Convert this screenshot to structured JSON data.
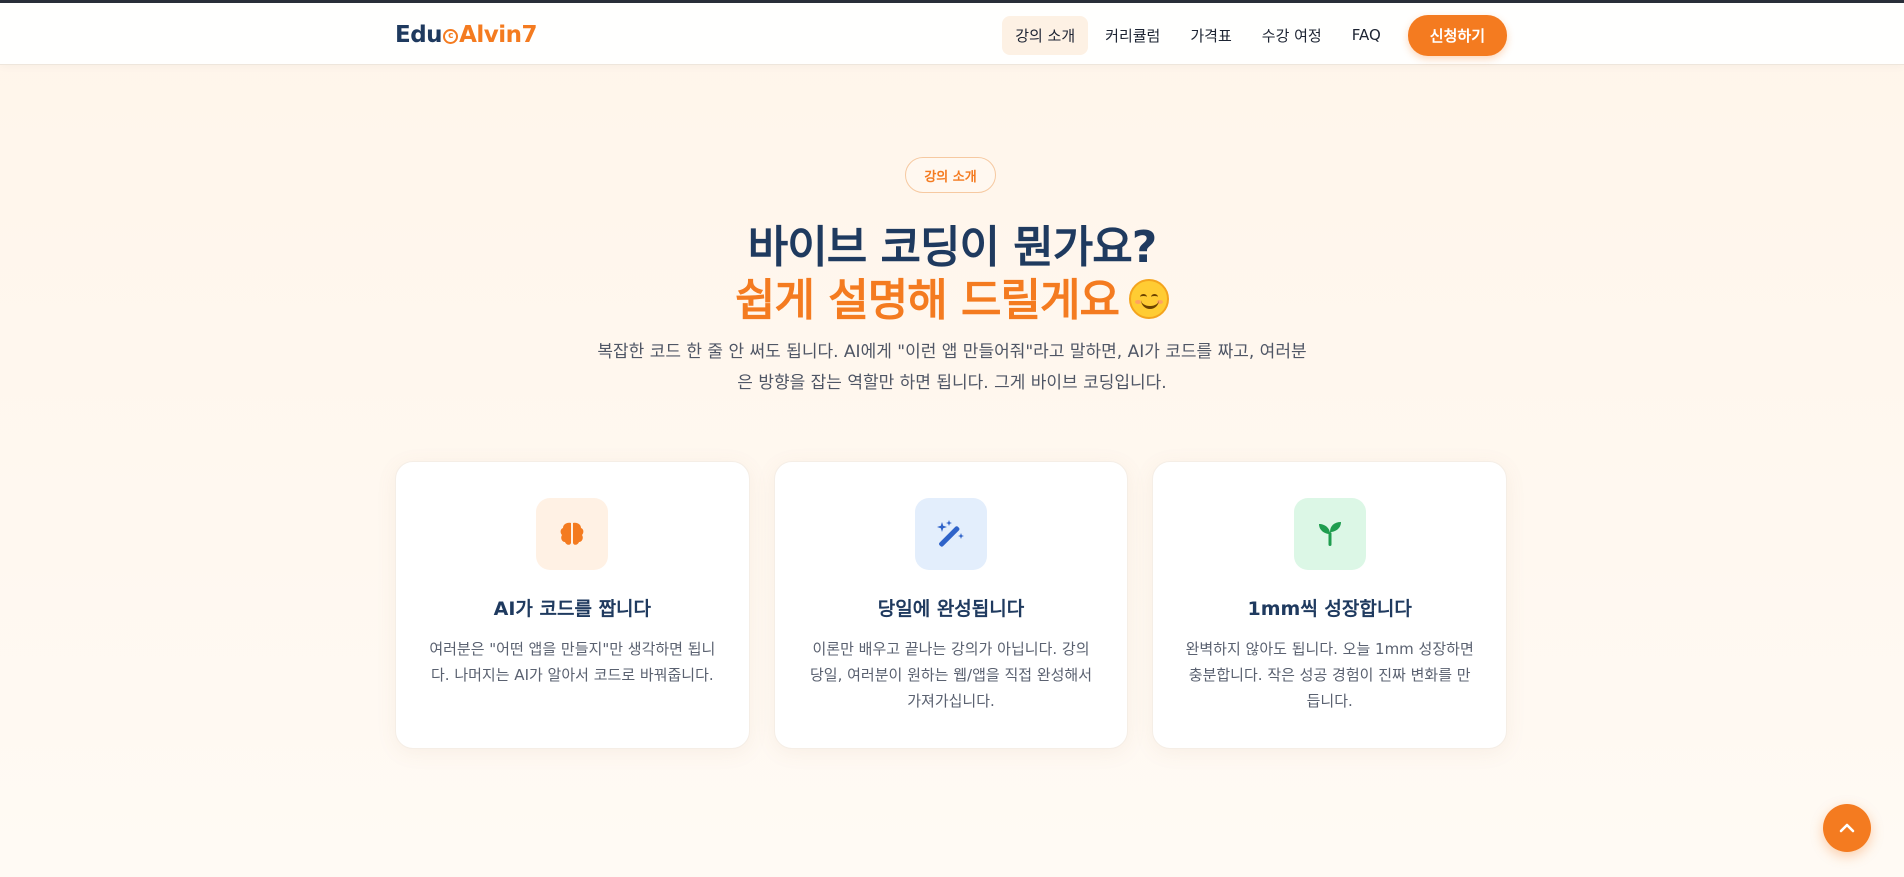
{
  "header": {
    "logo": {
      "part1": "Edu",
      "part2": "Alvin7"
    },
    "nav": [
      {
        "label": "강의 소개"
      },
      {
        "label": "커리큘럼"
      },
      {
        "label": "가격표"
      },
      {
        "label": "수강 여정"
      },
      {
        "label": "FAQ"
      }
    ],
    "cta_label": "신청하기"
  },
  "hero": {
    "badge": "강의 소개",
    "title_line1": "바이브 코딩이 뭔가요?",
    "title_line2": "쉽게 설명해 드릴게요",
    "description": "복잡한 코드 한 줄 안 써도 됩니다. AI에게 \"이런 앱 만들어줘\"라고 말하면, AI가 코드를 짜고, 여러분은 방향을 잡는 역할만 하면 됩니다. 그게 바이브 코딩입니다."
  },
  "cards": [
    {
      "icon": "brain-icon",
      "icon_bg": "#fff1e4",
      "icon_color": "#f47b20",
      "title": "AI가 코드를 짭니다",
      "text": "여러분은 \"어떤 앱을 만들지\"만 생각하면 됩니다. 나머지는 AI가 알아서 코드로 바꿔줍니다."
    },
    {
      "icon": "magic-wand-icon",
      "icon_bg": "#e3eefc",
      "icon_color": "#2f63c9",
      "title": "당일에 완성됩니다",
      "text": "이론만 배우고 끝나는 강의가 아닙니다. 강의 당일, 여러분이 원하는 웹/앱을 직접 완성해서 가져가십니다."
    },
    {
      "icon": "seedling-icon",
      "icon_bg": "#dcf7e6",
      "icon_color": "#1f9d4f",
      "title": "1mm씩 성장합니다",
      "text": "완벽하지 않아도 됩니다. 오늘 1mm 성장하면 충분합니다. 작은 성공 경험이 진짜 변화를 만듭니다."
    }
  ],
  "colors": {
    "accent": "#f47b20",
    "navy": "#1f3a5f"
  }
}
